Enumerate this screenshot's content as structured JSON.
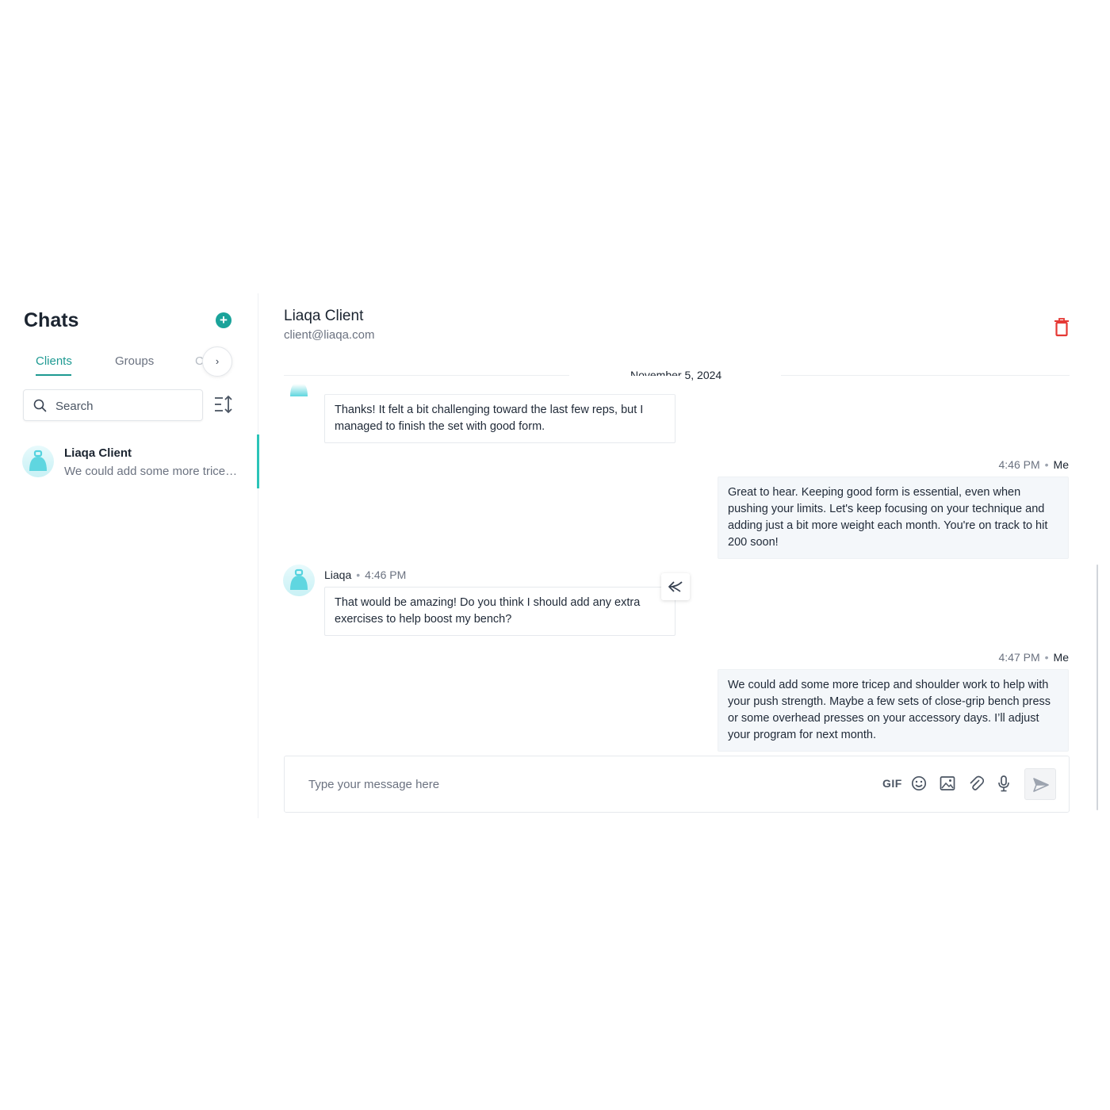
{
  "sidebar": {
    "title": "Chats",
    "tabs": [
      {
        "label": "Clients",
        "active": true
      },
      {
        "label": "Groups",
        "active": false
      }
    ],
    "tab_peek": "C",
    "tab_arrow": "›",
    "search": {
      "placeholder": "Search",
      "value": ""
    },
    "chats": [
      {
        "name": "Liaqa Client",
        "preview": "We could add some more tricep and shoulder work to help with your push strength.",
        "active": true
      }
    ]
  },
  "header": {
    "name": "Liaqa Client",
    "email": "client@liaqa.com"
  },
  "conversation": {
    "date": "November 5, 2024",
    "messages": [
      {
        "direction": "in",
        "sender": "",
        "time": "",
        "text": "Thanks! It felt a bit challenging toward the last few reps, but I managed to finish the set with good form."
      },
      {
        "direction": "out",
        "sender": "Me",
        "time": "4:46 PM",
        "text": "Great to hear. Keeping good form is essential, even when pushing your limits. Let's keep focusing on your technique and adding just a bit more weight each month. You're on track to hit 200 soon!"
      },
      {
        "direction": "in",
        "sender": "Liaqa",
        "time": "4:46 PM",
        "text": "That would be amazing! Do you think I should add any extra exercises to help boost my bench?"
      },
      {
        "direction": "out",
        "sender": "Me",
        "time": "4:47 PM",
        "text": "We could add some more tricep and shoulder work to help with your push strength. Maybe a few sets of close-grip bench press or some overhead presses on your accessory days. I’ll adjust your program for next month."
      }
    ]
  },
  "composer": {
    "placeholder": "Type your message here",
    "gif_label": "GIF"
  },
  "icons": {
    "add": "plus-circle-icon",
    "search": "search-icon",
    "sort": "sort-icon",
    "delete": "trash-icon",
    "reply": "reply-icon",
    "emoji": "emoji-icon",
    "image": "image-icon",
    "attach": "paperclip-icon",
    "mic": "microphone-icon",
    "send": "send-icon"
  },
  "colors": {
    "accent": "#1aa39a",
    "active_bar": "#2bc4b8",
    "avatar": "#5fd6e0",
    "danger": "#e53935"
  }
}
